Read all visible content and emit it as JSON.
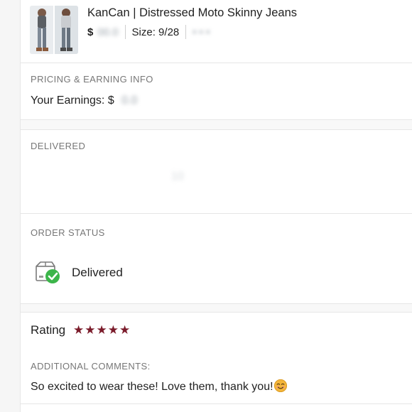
{
  "product": {
    "title": "KanCan | Distressed Moto Skinny Jeans",
    "price_prefix": "$",
    "price_hidden": "00.0",
    "size_text": "Size: 9/28",
    "extra_hidden": "• • •"
  },
  "pricing": {
    "section_label": "PRICING & EARNING INFO",
    "earnings_label": "Your Earnings: $",
    "earnings_hidden": "0.0"
  },
  "delivered": {
    "section_label": "DELIVERED",
    "hidden_value": "10"
  },
  "order_status": {
    "section_label": "ORDER STATUS",
    "status": "Delivered",
    "icon": "package-delivered-icon"
  },
  "rating": {
    "label": "Rating",
    "stars": 5,
    "star_color": "#7b1c2b"
  },
  "comments": {
    "section_label": "ADDITIONAL COMMENTS:",
    "text": "So excited to wear these! Love them, thank you!",
    "emoji": "smiling-face-icon"
  },
  "colors": {
    "check_green": "#3cb54a",
    "emoji_yellow": "#f3b53a"
  }
}
